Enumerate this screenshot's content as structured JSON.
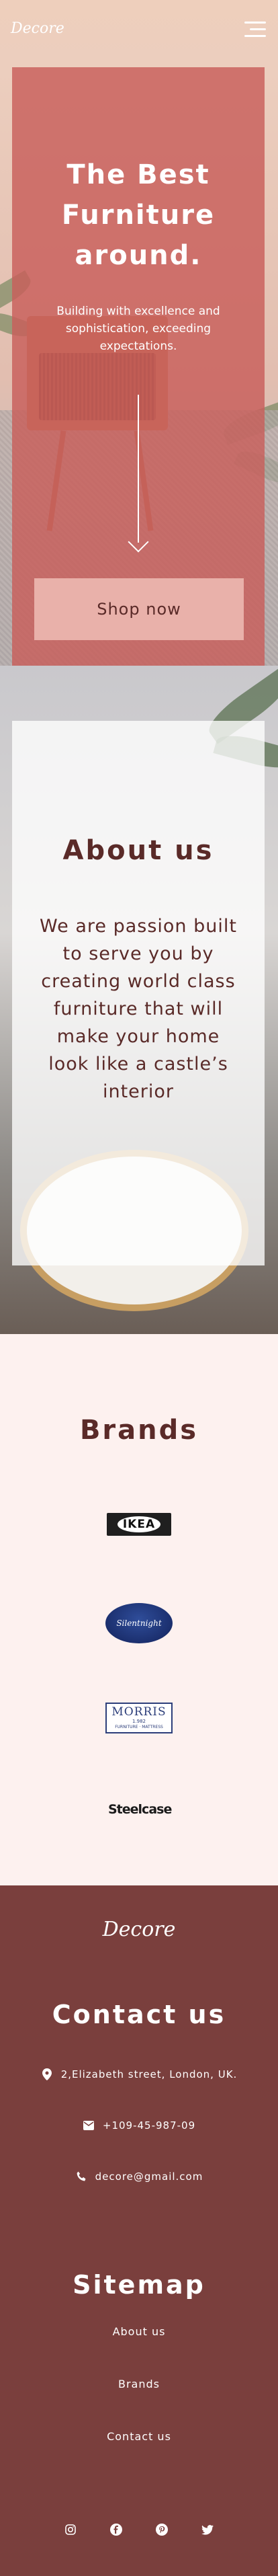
{
  "header": {
    "logo": "Decore",
    "menu_icon": "hamburger-menu-icon"
  },
  "hero": {
    "title_line1": "The Best",
    "title_line2": "Furniture",
    "title_line3": "around.",
    "subtitle": "Building with excellence and sophistication, exceeding expectations.",
    "scroll_icon": "arrow-down-icon",
    "cta_label": "Shop now"
  },
  "about": {
    "title": "About us",
    "text": "We are passion built to serve you by creating world class furniture that will make your home look like a castle’s interior"
  },
  "brands": {
    "title": "Brands",
    "items": [
      {
        "name": "IKEA",
        "text": "IKEA"
      },
      {
        "name": "Silentnight",
        "text": "Silentnight"
      },
      {
        "name": "Morris",
        "text": "MORRIS",
        "sub1": "1.982",
        "sub2": "FURNITURE · MATTRESS"
      },
      {
        "name": "Steelcase",
        "text": "Steelcase"
      }
    ]
  },
  "footer": {
    "logo": "Decore",
    "contact_title": "Contact us",
    "address": "2,Elizabeth street, London, UK.",
    "phone": "+109-45-987-09",
    "email": "decore@gmail.com",
    "sitemap_title": "Sitemap",
    "sitemap_links": [
      "About us",
      "Brands",
      "Contact us"
    ],
    "social_icons": [
      "instagram-icon",
      "facebook-icon",
      "pinterest-icon",
      "twitter-icon"
    ]
  },
  "colors": {
    "hero_overlay": "#c85e5a",
    "footer_bg": "#7a3f3d",
    "brands_bg": "#fdf1ef",
    "text_dark": "#5a2a28",
    "button_bg": "#e9b1aa"
  }
}
